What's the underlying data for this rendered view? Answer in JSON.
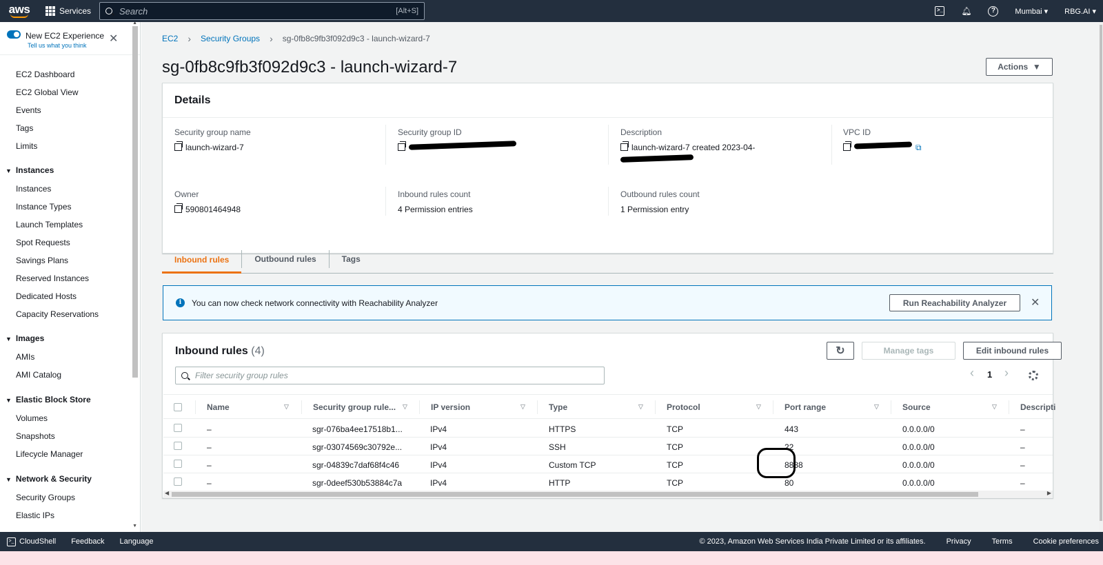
{
  "topnav": {
    "logo": "aws",
    "services": "Services",
    "search_placeholder": "Search",
    "search_hint": "[Alt+S]",
    "region": "Mumbai",
    "account": "RBG.AI",
    "icons": [
      "cloudshell-icon",
      "bell-icon",
      "help-icon"
    ]
  },
  "sidebar": {
    "experience_title": "New EC2 Experience",
    "experience_sub": "Tell us what you think",
    "items_top": [
      "EC2 Dashboard",
      "EC2 Global View",
      "Events",
      "Tags",
      "Limits"
    ],
    "instances_head": "Instances",
    "instances": [
      "Instances",
      "Instance Types",
      "Launch Templates",
      "Spot Requests",
      "Savings Plans",
      "Reserved Instances",
      "Dedicated Hosts",
      "Capacity Reservations"
    ],
    "images_head": "Images",
    "images": [
      "AMIs",
      "AMI Catalog"
    ],
    "ebs_head": "Elastic Block Store",
    "ebs": [
      "Volumes",
      "Snapshots",
      "Lifecycle Manager"
    ],
    "netsec_head": "Network & Security",
    "netsec": [
      "Security Groups",
      "Elastic IPs"
    ]
  },
  "breadcrumb": {
    "ec2": "EC2",
    "security_groups": "Security Groups",
    "current": "sg-0fb8c9fb3f092d9c3 - launch-wizard-7"
  },
  "page_title": "sg-0fb8c9fb3f092d9c3 - launch-wizard-7",
  "actions_label": "Actions",
  "details": {
    "heading": "Details",
    "sg_name_label": "Security group name",
    "sg_name": "launch-wizard-7",
    "sg_id_label": "Security group ID",
    "description_label": "Description",
    "description": "launch-wizard-7 created 2023-04-",
    "vpc_label": "VPC ID",
    "owner_label": "Owner",
    "owner": "590801464948",
    "inbound_count_label": "Inbound rules count",
    "inbound_count": "4 Permission entries",
    "outbound_count_label": "Outbound rules count",
    "outbound_count": "1 Permission entry"
  },
  "tabs": [
    "Inbound rules",
    "Outbound rules",
    "Tags"
  ],
  "alert": {
    "message": "You can now check network connectivity with Reachability Analyzer",
    "button": "Run Reachability Analyzer"
  },
  "inbound": {
    "title": "Inbound rules",
    "count": "(4)",
    "manage_tags": "Manage tags",
    "edit": "Edit inbound rules",
    "filter_placeholder": "Filter security group rules",
    "page": "1",
    "columns": [
      "Name",
      "Security group rule...",
      "IP version",
      "Type",
      "Protocol",
      "Port range",
      "Source",
      "Descripti"
    ],
    "rows": [
      {
        "name": "–",
        "rule": "sgr-076ba4ee17518b1...",
        "ip": "IPv4",
        "type": "HTTPS",
        "protocol": "TCP",
        "port": "443",
        "source": "0.0.0.0/0",
        "desc": "–"
      },
      {
        "name": "–",
        "rule": "sgr-03074569c30792e...",
        "ip": "IPv4",
        "type": "SSH",
        "protocol": "TCP",
        "port": "22",
        "source": "0.0.0.0/0",
        "desc": "–"
      },
      {
        "name": "–",
        "rule": "sgr-04839c7daf68f4c46",
        "ip": "IPv4",
        "type": "Custom TCP",
        "protocol": "TCP",
        "port": "8888",
        "source": "0.0.0.0/0",
        "desc": "–"
      },
      {
        "name": "–",
        "rule": "sgr-0deef530b53884c7a",
        "ip": "IPv4",
        "type": "HTTP",
        "protocol": "TCP",
        "port": "80",
        "source": "0.0.0.0/0",
        "desc": "–"
      }
    ]
  },
  "footer": {
    "cloudshell": "CloudShell",
    "feedback": "Feedback",
    "language": "Language",
    "copyright": "© 2023, Amazon Web Services India Private Limited or its affiliates.",
    "privacy": "Privacy",
    "terms": "Terms",
    "cookie": "Cookie preferences"
  }
}
